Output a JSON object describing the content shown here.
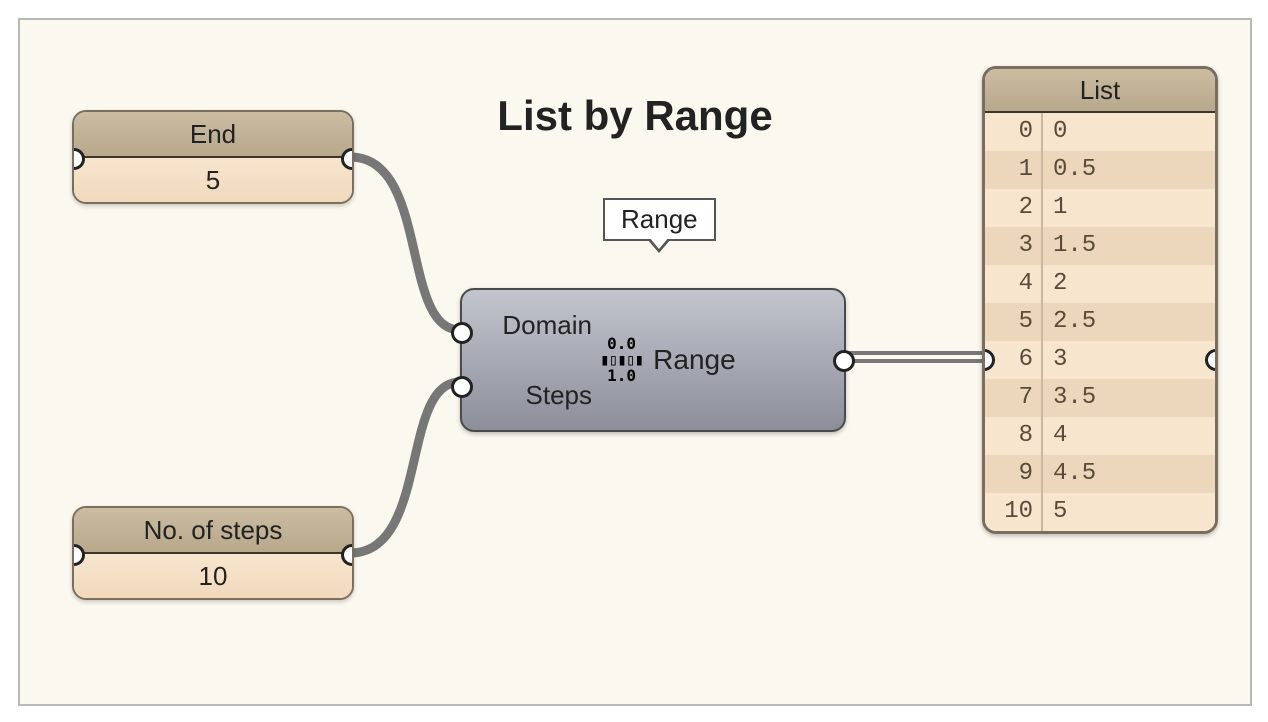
{
  "title": "List by Range",
  "tooltip": "Range",
  "nodes": {
    "end": {
      "label": "End",
      "value": "5"
    },
    "steps": {
      "label": "No. of steps",
      "value": "10"
    },
    "range": {
      "input_domain": "Domain",
      "input_steps": "Steps",
      "output": "Range",
      "icon_top": "0.0",
      "icon_bot": "1.0"
    }
  },
  "list": {
    "header": "List",
    "rows": [
      {
        "idx": "0",
        "val": "0"
      },
      {
        "idx": "1",
        "val": "0.5"
      },
      {
        "idx": "2",
        "val": "1"
      },
      {
        "idx": "3",
        "val": "1.5"
      },
      {
        "idx": "4",
        "val": "2"
      },
      {
        "idx": "5",
        "val": "2.5"
      },
      {
        "idx": "6",
        "val": "3"
      },
      {
        "idx": "7",
        "val": "3.5"
      },
      {
        "idx": "8",
        "val": "4"
      },
      {
        "idx": "9",
        "val": "4.5"
      },
      {
        "idx": "10",
        "val": "5"
      }
    ]
  }
}
